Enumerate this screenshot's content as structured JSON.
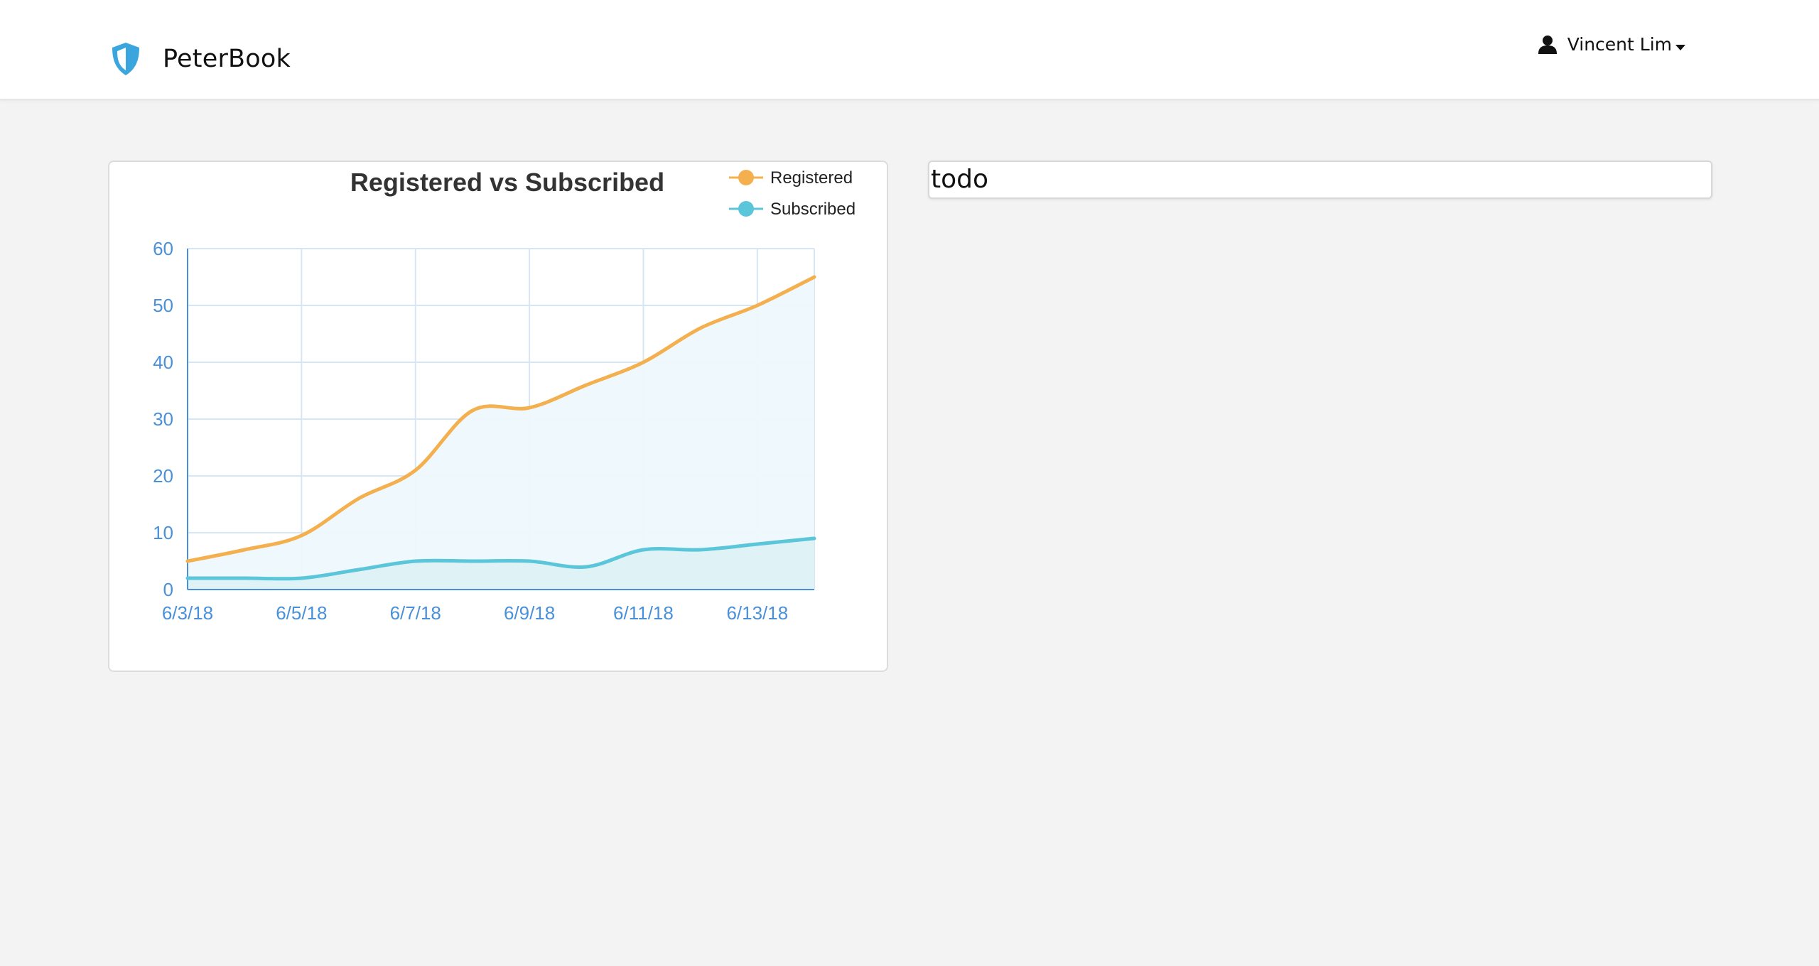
{
  "app": {
    "name": "PeterBook",
    "icon": "shield-icon",
    "brand_color": "#3aa6dd"
  },
  "user_menu": {
    "name": "Vincent Lim",
    "icon": "user-icon",
    "caret_icon": "caret-down-icon"
  },
  "todo_panel": {
    "text": "todo"
  },
  "chart_data": {
    "type": "area",
    "title": "Registered vs Subscribed",
    "xlabel": "",
    "ylabel": "",
    "x": [
      "6/3/18",
      "6/4/18",
      "6/5/18",
      "6/6/18",
      "6/7/18",
      "6/8/18",
      "6/9/18",
      "6/10/18",
      "6/11/18",
      "6/12/18",
      "6/13/18",
      "6/14/18"
    ],
    "x_tick_labels": [
      "6/3/18",
      "6/5/18",
      "6/7/18",
      "6/9/18",
      "6/11/18",
      "6/13/18"
    ],
    "ylim": [
      0,
      60
    ],
    "y_ticks": [
      0,
      10,
      20,
      30,
      40,
      50,
      60
    ],
    "grid": true,
    "legend_position": "top-right",
    "series": [
      {
        "name": "Registered",
        "color": "#f4b04e",
        "values": [
          5,
          7,
          9.5,
          16,
          21,
          31.5,
          32,
          36,
          40,
          46,
          50,
          55
        ]
      },
      {
        "name": "Subscribed",
        "color": "#5bc6da",
        "values": [
          2,
          2,
          2,
          3.5,
          5,
          5,
          5,
          4,
          7,
          7,
          8,
          9
        ]
      }
    ],
    "area_fill_color": "#e3f4fa",
    "axis_color": "#4a90d9",
    "grid_color": "#d6e6f5"
  }
}
